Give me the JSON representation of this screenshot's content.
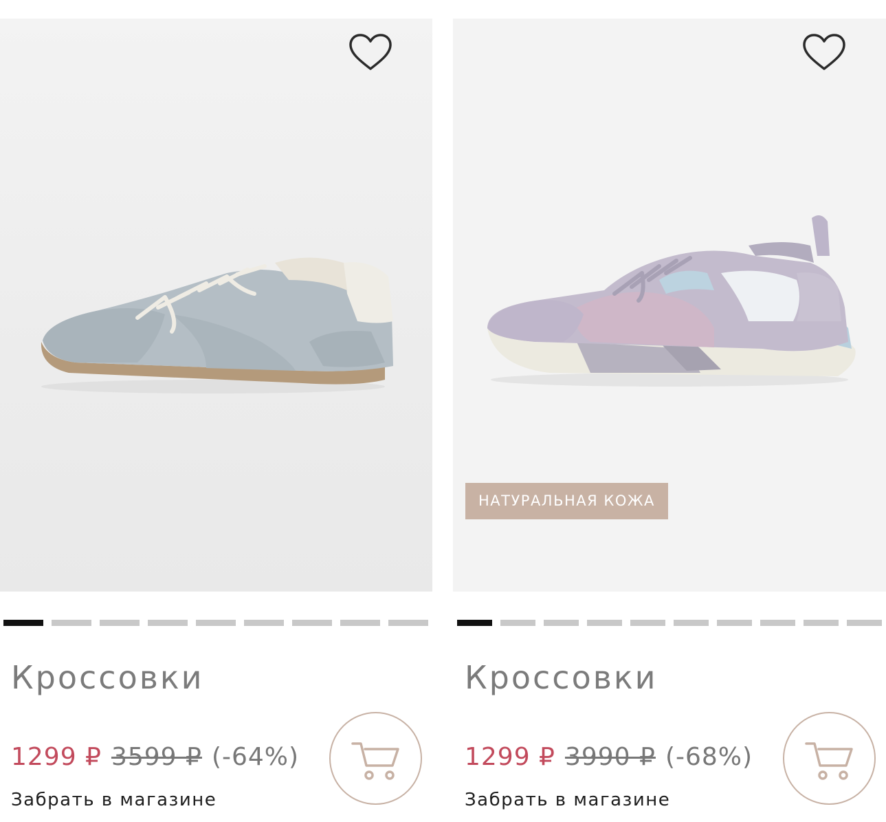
{
  "products": [
    {
      "title": "Кроссовки",
      "price_now": "1299 ₽",
      "price_old": "3599 ₽",
      "discount": "(-64%)",
      "pickup": "Забрать в магазине",
      "badge": "",
      "photo_alt": "",
      "gallery_total": 9,
      "gallery_active": 1
    },
    {
      "title": "Кроссовки",
      "price_now": "1299 ₽",
      "price_old": "3990 ₽",
      "discount": "(-68%)",
      "pickup": "Забрать в магазине",
      "badge": "НАТУРАЛЬНАЯ КОЖА",
      "photo_alt": "",
      "gallery_total": 10,
      "gallery_active": 1
    }
  ],
  "icons": {
    "favorite": "heart-outline-icon",
    "cart": "cart-icon"
  },
  "colors": {
    "price_now": "#c24a5c",
    "badge_bg": "#c8b2a4",
    "cart_border": "#c7b1a4",
    "dot_active": "#111111",
    "dot_inactive": "#c8c8c8"
  }
}
